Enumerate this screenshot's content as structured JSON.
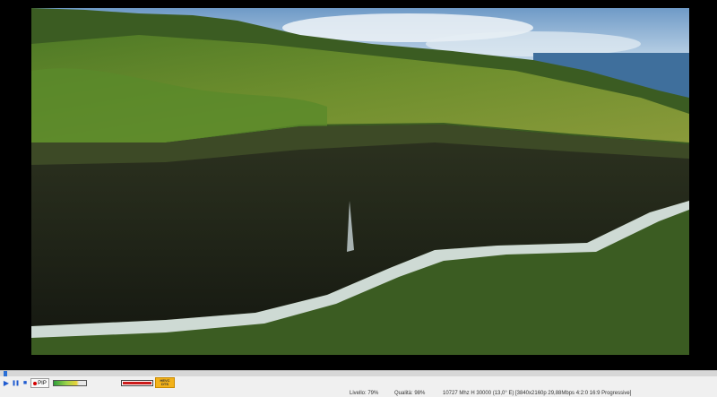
{
  "player": {
    "seek_progress": 0.005,
    "volume_level": 0.95,
    "signal_level": 0.78
  },
  "controls": {
    "play_icon": "▶",
    "pause_icon": "❚❚",
    "stop_icon": "■",
    "pip_label": "PIP",
    "codec_top": "HEVC",
    "codec_bottom": "DTS"
  },
  "status": {
    "level": "Livello: 79%",
    "quality": "Qualità: 98%",
    "tuning": "10727 Mhz  H  30000  (13,0° E)",
    "format": "[3840x2160p  29,88Mbps 4:2:0  16:9 Progressive]"
  },
  "colors": {
    "accent": "#2a6fd6",
    "record": "#d40000",
    "volume": "#cc1a1a",
    "codec_badge": "#f3b21a"
  }
}
